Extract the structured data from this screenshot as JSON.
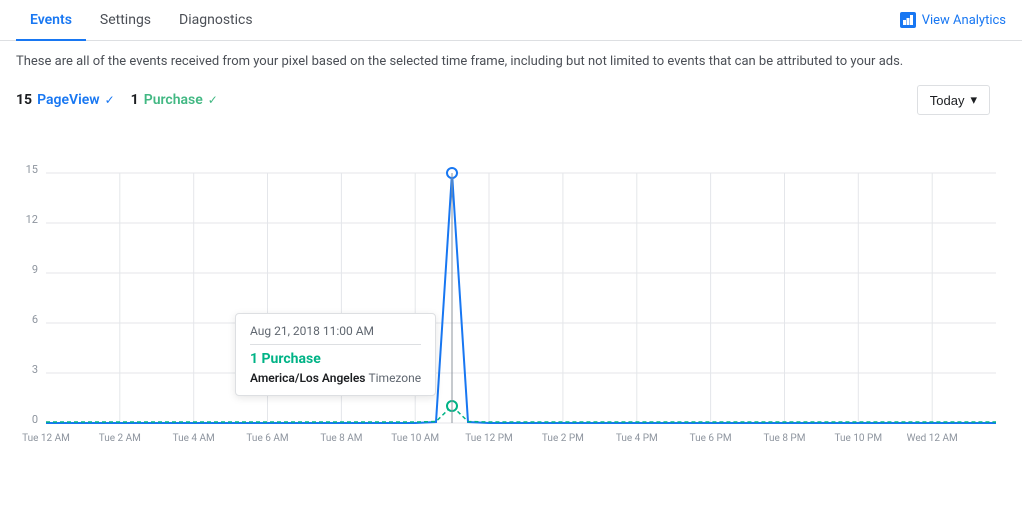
{
  "tabs": [
    {
      "id": "events",
      "label": "Events",
      "active": true
    },
    {
      "id": "settings",
      "label": "Settings",
      "active": false
    },
    {
      "id": "diagnostics",
      "label": "Diagnostics",
      "active": false
    }
  ],
  "header": {
    "view_analytics_label": "View Analytics"
  },
  "description": "These are all of the events received from your pixel based on the selected time frame, including but not limited to events that can be attributed to your ads.",
  "legend": {
    "pageview_count": "15",
    "pageview_label": "PageView",
    "purchase_count": "1",
    "purchase_label": "Purchase"
  },
  "today_button": "Today",
  "tooltip": {
    "date": "Aug 21, 2018 11:00 AM",
    "value": "1",
    "event_label": "Purchase",
    "timezone_label": "America/Los Angeles",
    "timezone_suffix": "Timezone"
  },
  "x_axis_labels": [
    "Tue 12 AM",
    "Tue 2 AM",
    "Tue 4 AM",
    "Tue 6 AM",
    "Tue 8 AM",
    "Tue 10 AM",
    "Tue 12 PM",
    "Tue 2 PM",
    "Tue 4 PM",
    "Tue 6 PM",
    "Tue 8 PM",
    "Tue 10 PM",
    "Wed 12 AM"
  ],
  "y_axis_labels": [
    "0",
    "3",
    "6",
    "9",
    "12",
    "15"
  ],
  "colors": {
    "blue": "#1877f2",
    "green": "#00b386",
    "grid": "#e4e6ea",
    "axis": "#8d949e"
  }
}
